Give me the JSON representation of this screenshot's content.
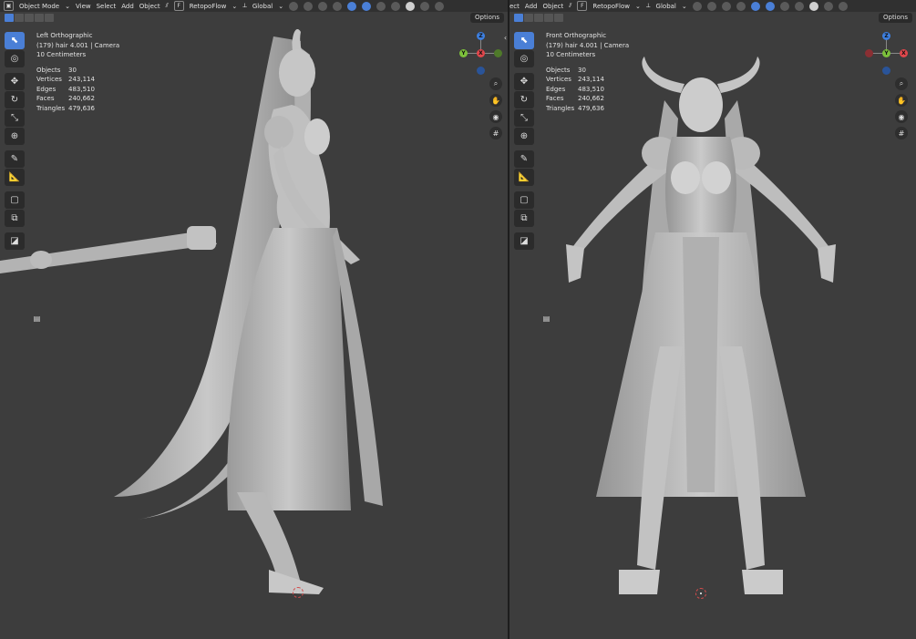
{
  "left_view": {
    "header": {
      "mode": "Object Mode",
      "menus": [
        "View",
        "Select",
        "Add",
        "Object"
      ],
      "addon": "RetopoFlow",
      "transform": "Global"
    },
    "options_label": "Options",
    "view_name": "Left Orthographic",
    "object_info": "(179) hair 4.001 | Camera",
    "scale": "10 Centimeters",
    "stats": [
      {
        "label": "Objects",
        "value": "30"
      },
      {
        "label": "Vertices",
        "value": "243,114"
      },
      {
        "label": "Edges",
        "value": "483,510"
      },
      {
        "label": "Faces",
        "value": "240,662"
      },
      {
        "label": "Triangles",
        "value": "479,636"
      }
    ],
    "gizmo": {
      "top": "Z",
      "center": "X",
      "left": "Y"
    }
  },
  "right_view": {
    "header": {
      "mode_fragment": "ect",
      "menus": [
        "Add",
        "Object"
      ],
      "addon": "RetopoFlow",
      "transform": "Global"
    },
    "options_label": "Options",
    "view_name": "Front Orthographic",
    "object_info": "(179) hair 4.001 | Camera",
    "scale": "10 Centimeters",
    "stats": [
      {
        "label": "Objects",
        "value": "30"
      },
      {
        "label": "Vertices",
        "value": "243,114"
      },
      {
        "label": "Edges",
        "value": "483,510"
      },
      {
        "label": "Faces",
        "value": "240,662"
      },
      {
        "label": "Triangles",
        "value": "479,636"
      }
    ],
    "gizmo": {
      "top": "Z",
      "center": "Y",
      "right": "X"
    }
  },
  "icons": {
    "mode_key": "F",
    "tools": [
      "select-box-icon",
      "cursor-icon",
      "move-icon",
      "rotate-icon",
      "scale-icon",
      "transform-icon",
      "annotate-icon",
      "measure-icon",
      "add-cube-icon",
      "extrude-icon",
      "shading-icon"
    ],
    "nav": [
      "zoom-icon",
      "hand-pan-icon",
      "camera-icon",
      "grid-icon"
    ]
  },
  "colors": {
    "accent": "#4a7fd6",
    "axis_x": "#e0474c",
    "axis_y": "#7cc13b",
    "axis_z": "#3d7fe0",
    "viewport_bg": "#3d3d3d",
    "model": "#b9b9b9"
  }
}
